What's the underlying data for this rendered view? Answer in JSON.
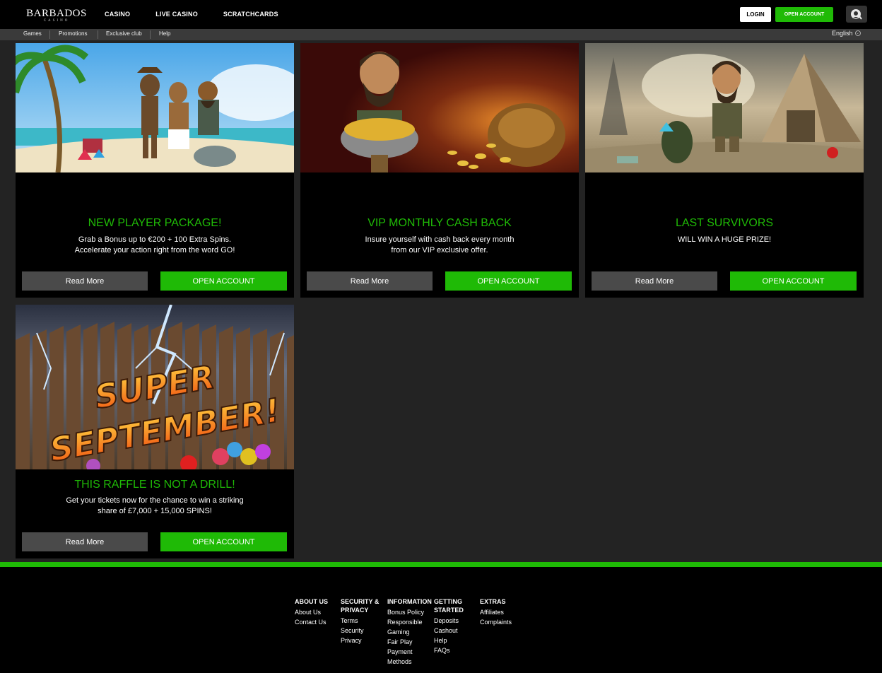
{
  "header": {
    "logo_main": "BARBADOS",
    "logo_sub": "CASINO",
    "nav": [
      "CASINO",
      "LIVE CASINO",
      "SCRATCHCARDS"
    ],
    "login": "LOGIN",
    "open_account": "OPEN ACCOUNT",
    "support_icon": "chat-support-icon"
  },
  "subnav": {
    "items": [
      "Games",
      "Promotions",
      "Exclusive club",
      "Help"
    ],
    "language": "English"
  },
  "promos": [
    {
      "title": "NEW PLAYER PACKAGE!",
      "text_lines": [
        "Grab a Bonus up to €200 + 100 Extra Spins.",
        "Accelerate your action right from the word GO!"
      ],
      "read_more": "Read More",
      "open_account": "OPEN ACCOUNT"
    },
    {
      "title": "VIP MONTHLY CASH BACK",
      "text_lines": [
        "Insure yourself with cash back every month",
        "from our VIP exclusive offer."
      ],
      "read_more": "Read More",
      "open_account": "OPEN ACCOUNT"
    },
    {
      "title": "LAST SURVIVORS",
      "text_lines": [
        "WILL WIN A HUGE PRIZE!"
      ],
      "read_more": "Read More",
      "open_account": "OPEN ACCOUNT"
    },
    {
      "title": "THIS RAFFLE IS NOT A DRILL!",
      "text_lines": [
        "Get your tickets now for the chance to win a striking",
        "share of £7,000 + 15,000 SPINS!"
      ],
      "read_more": "Read More",
      "open_account": "OPEN ACCOUNT",
      "image_text_1": "SUPER",
      "image_text_2": "SEPTEMBER!"
    }
  ],
  "footer": {
    "columns": [
      {
        "heading_lines": [
          "ABOUT US"
        ],
        "links": [
          "About Us",
          "Contact Us"
        ]
      },
      {
        "heading_lines": [
          "SECURITY &",
          "PRIVACY"
        ],
        "links": [
          "Terms",
          "Security",
          "Privacy"
        ]
      },
      {
        "heading_lines": [
          "INFORMATION"
        ],
        "links": [
          "Bonus Policy",
          "Responsible",
          "Gaming",
          "Fair Play",
          "Payment",
          "Methods"
        ]
      },
      {
        "heading_lines": [
          "GETTING",
          "STARTED"
        ],
        "links": [
          "Deposits",
          "Cashout",
          "Help",
          "FAQs"
        ]
      },
      {
        "heading_lines": [
          "EXTRAS"
        ],
        "links": [
          "Affiliates",
          "Complaints"
        ]
      }
    ]
  },
  "colors": {
    "accent": "#1fba06",
    "background": "#232323",
    "card": "#000000",
    "button_grey": "#4a4a4a"
  }
}
